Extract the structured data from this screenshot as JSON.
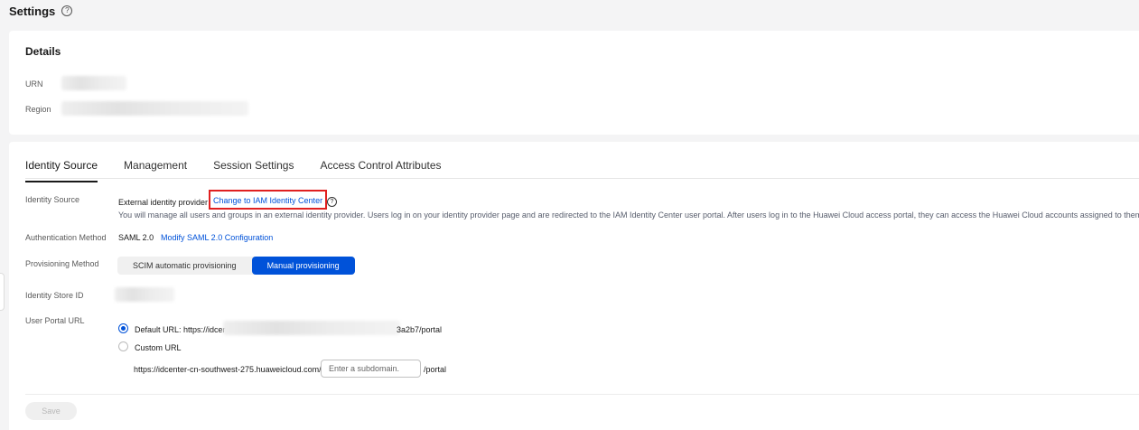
{
  "page": {
    "title": "Settings"
  },
  "details": {
    "title": "Details",
    "urn_label": "URN",
    "region_label": "Region"
  },
  "tabs": [
    {
      "label": "Identity Source",
      "active": true
    },
    {
      "label": "Management",
      "active": false
    },
    {
      "label": "Session Settings",
      "active": false
    },
    {
      "label": "Access Control Attributes",
      "active": false
    }
  ],
  "identity_source": {
    "label": "Identity Source",
    "value": "External identity provider",
    "change_link": "Change to IAM Identity Center",
    "description": "You will manage all users and groups in an external identity provider. Users log in on your identity provider page and are redirected to the IAM Identity Center user portal. After users log in to the Huawei Cloud access portal, they can access the Huawei Cloud accounts assigned to them."
  },
  "authentication": {
    "label": "Authentication Method",
    "value": "SAML 2.0",
    "modify_link": "Modify SAML 2.0 Configuration"
  },
  "provisioning": {
    "label": "Provisioning Method",
    "options": [
      "SCIM automatic provisioning",
      "Manual provisioning"
    ],
    "selected": "Manual provisioning"
  },
  "identity_store": {
    "label": "Identity Store ID"
  },
  "user_portal": {
    "label": "User Portal URL",
    "default_prefix": "Default URL: https://idcer",
    "default_suffix": "3a2b7/portal",
    "custom_label": "Custom URL",
    "custom_prefix": "https://idcenter-cn-southwest-275.huaweicloud.com/",
    "subdomain_placeholder": "Enter a subdomain.",
    "custom_suffix": "/portal",
    "selected": "default"
  },
  "footer": {
    "save_label": "Save"
  },
  "colors": {
    "accent": "#0052d9",
    "highlight_border": "#e02020"
  }
}
